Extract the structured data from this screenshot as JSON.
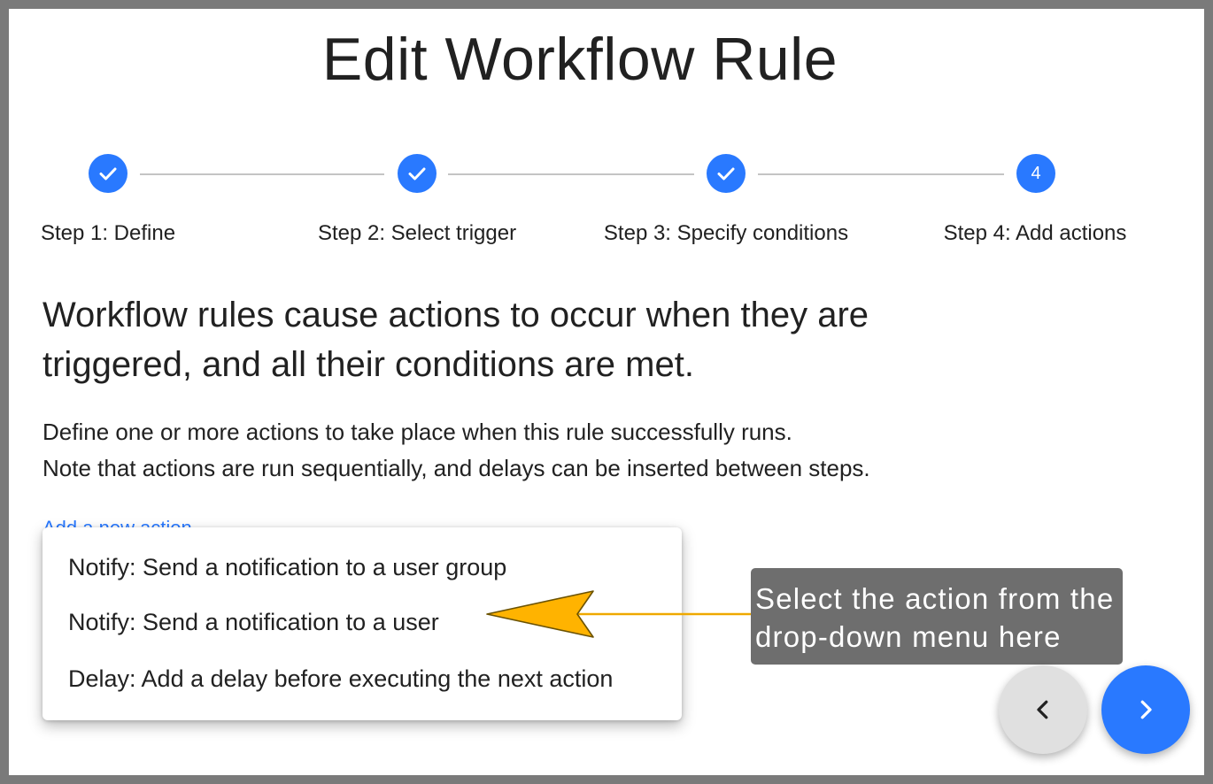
{
  "page": {
    "title": "Edit Workflow Rule",
    "headline_line1": "Workflow rules cause actions to occur when they are",
    "headline_line2": "triggered, and all their conditions are met.",
    "description_line1": "Define one or more actions to take place when this rule successfully runs.",
    "description_line2": "Note that actions are run sequentially, and delays can be inserted between steps.",
    "add_action_link": "Add a new action"
  },
  "stepper": {
    "steps": [
      {
        "label": "Step 1: Define",
        "state": "completed",
        "icon": "check-icon"
      },
      {
        "label": "Step 2: Select trigger",
        "state": "completed",
        "icon": "check-icon"
      },
      {
        "label": "Step 3: Specify conditions",
        "state": "completed",
        "icon": "check-icon"
      },
      {
        "label": "Step 4: Add actions",
        "state": "active",
        "number": "4"
      }
    ],
    "accent_color": "#2979ff"
  },
  "action_menu": {
    "items": [
      "Notify: Send a notification to a user group",
      "Notify: Send a notification to a user",
      "Delay: Add a delay before executing the next action"
    ]
  },
  "callout": {
    "line1": "Select the action from the",
    "line2": "drop-down menu here",
    "arrow_color": "#ffb300"
  },
  "navigation": {
    "prev_icon": "chevron-left-icon",
    "next_icon": "chevron-right-icon"
  }
}
